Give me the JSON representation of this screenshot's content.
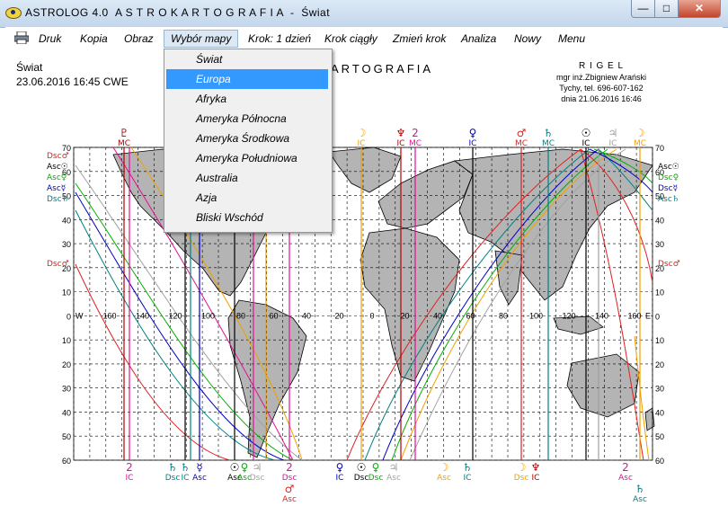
{
  "window": {
    "app_name": "ASTROLOG 4.0",
    "title": "A S T R O K A R T O G R A F I A  -  Świat",
    "minimize": "—",
    "maximize": "□",
    "close": "✕"
  },
  "menu": {
    "items": [
      "Druk",
      "Kopia",
      "Obraz",
      "Wybór mapy",
      "Krok: 1 dzień",
      "Krok ciągły",
      "Zmień krok",
      "Analiza",
      "Nowy",
      "Menu"
    ],
    "active_index": 3
  },
  "dropdown": {
    "items": [
      "Świat",
      "Europa",
      "Afryka",
      "Ameryka Północna",
      "Ameryka Środkowa",
      "Ameryka Południowa",
      "Australia",
      "Azja",
      "Bliski Wschód"
    ],
    "selected_index": 1
  },
  "chart_info": {
    "place": "Świat",
    "datetime": "23.06.2016  16:45  CWE",
    "heading": "ARTOGRAFIA"
  },
  "author": {
    "name": "R I G E L",
    "line1": "mgr inż.Zbigniew Arański",
    "line2": "Tychy, tel. 696-607-162",
    "line3": "dnia 21.06.2016  16:46"
  },
  "map": {
    "lat_labels": [
      "70",
      "60",
      "50",
      "40",
      "30",
      "20",
      "10",
      "0",
      "10",
      "20",
      "30",
      "40",
      "50",
      "60"
    ],
    "lon_labels": [
      "160",
      "140",
      "120",
      "100",
      "80",
      "60",
      "40",
      "20",
      "0",
      "20",
      "40",
      "60",
      "80",
      "100",
      "120",
      "140",
      "160"
    ],
    "west_label": "W",
    "east_label": "E",
    "colors": {
      "planet_pink": "#e0109a",
      "planet_orange": "#f0a000",
      "planet_red": "#e02020",
      "planet_blue": "#0000c0",
      "planet_teal": "#008080",
      "planet_green": "#00b000",
      "planet_grey": "#a0a0a0",
      "land": "#b4b4b4",
      "grid": "#000000"
    },
    "left_labels": [
      {
        "text": "Dsc♂",
        "color": "#e02020"
      },
      {
        "text": "Asc☉",
        "color": "#000000"
      },
      {
        "text": "Asc♀",
        "color": "#00b000"
      },
      {
        "text": "Asc☿",
        "color": "#0000c0"
      },
      {
        "text": "Dsc♄",
        "color": "#008080"
      },
      {
        "text": "Dsc♂",
        "color": "#e02020"
      }
    ],
    "right_labels": [
      {
        "text": "Asc☉",
        "color": "#000000"
      },
      {
        "text": "Dsc♀",
        "color": "#00b000"
      },
      {
        "text": "Dsc☿",
        "color": "#0000c0"
      },
      {
        "text": "Asc♄",
        "color": "#008080"
      },
      {
        "text": "Dsc♂",
        "color": "#e02020"
      }
    ],
    "top_symbols": [
      {
        "sym": "♇",
        "sub": "MC",
        "color": "#b00000"
      },
      {
        "sym": "☽",
        "sub": "IC",
        "color": "#f0a000"
      },
      {
        "sym": "♆",
        "sub": "IC",
        "color": "#b00000"
      },
      {
        "sym": "2",
        "sub": "MC",
        "color": "#e0109a"
      },
      {
        "sym": "♀",
        "sub": "IC",
        "color": "#0000c0"
      },
      {
        "sym": "♂",
        "sub": "MC",
        "color": "#e02020"
      },
      {
        "sym": "♄",
        "sub": "MC",
        "color": "#008080"
      },
      {
        "sym": "☉",
        "sub": "IC",
        "color": "#000000"
      },
      {
        "sym": "♃",
        "sub": "IC",
        "color": "#a0a0a0"
      },
      {
        "sym": "☽",
        "sub": "MC",
        "color": "#f0a000"
      }
    ],
    "bottom_symbols": [
      {
        "sym": "2",
        "sub": "IC",
        "color": "#e0109a"
      },
      {
        "sym": "♄",
        "sub": "Dsc",
        "color": "#008080"
      },
      {
        "sym": "♄",
        "sub": "IC",
        "color": "#008080"
      },
      {
        "sym": "☿",
        "sub": "Asc",
        "color": "#0000c0"
      },
      {
        "sym": "☉",
        "sub": "Asc",
        "color": "#000000"
      },
      {
        "sym": "♀",
        "sub": "Asc",
        "color": "#00b000"
      },
      {
        "sym": "♃",
        "sub": "Dsc",
        "color": "#a0a0a0"
      },
      {
        "sym": "2",
        "sub": "Dsc",
        "color": "#e0109a"
      },
      {
        "sym": "♂",
        "sub": "Asc",
        "color": "#e02020"
      },
      {
        "sym": "♀",
        "sub": "IC",
        "color": "#0000c0"
      },
      {
        "sym": "☉",
        "sub": "Dsc",
        "color": "#000000"
      },
      {
        "sym": "♀",
        "sub": "Dsc",
        "color": "#00b000"
      },
      {
        "sym": "♃",
        "sub": "Asc",
        "color": "#a0a0a0"
      },
      {
        "sym": "☽",
        "sub": "Asc",
        "color": "#f0a000"
      },
      {
        "sym": "♄",
        "sub": "IC",
        "color": "#008080"
      },
      {
        "sym": "☽",
        "sub": "Dsc",
        "color": "#f0a000"
      },
      {
        "sym": "♆",
        "sub": "IC",
        "color": "#b00000"
      },
      {
        "sym": "2",
        "sub": "Asc",
        "color": "#e0109a"
      },
      {
        "sym": "♄",
        "sub": "Asc",
        "color": "#008080"
      }
    ]
  }
}
